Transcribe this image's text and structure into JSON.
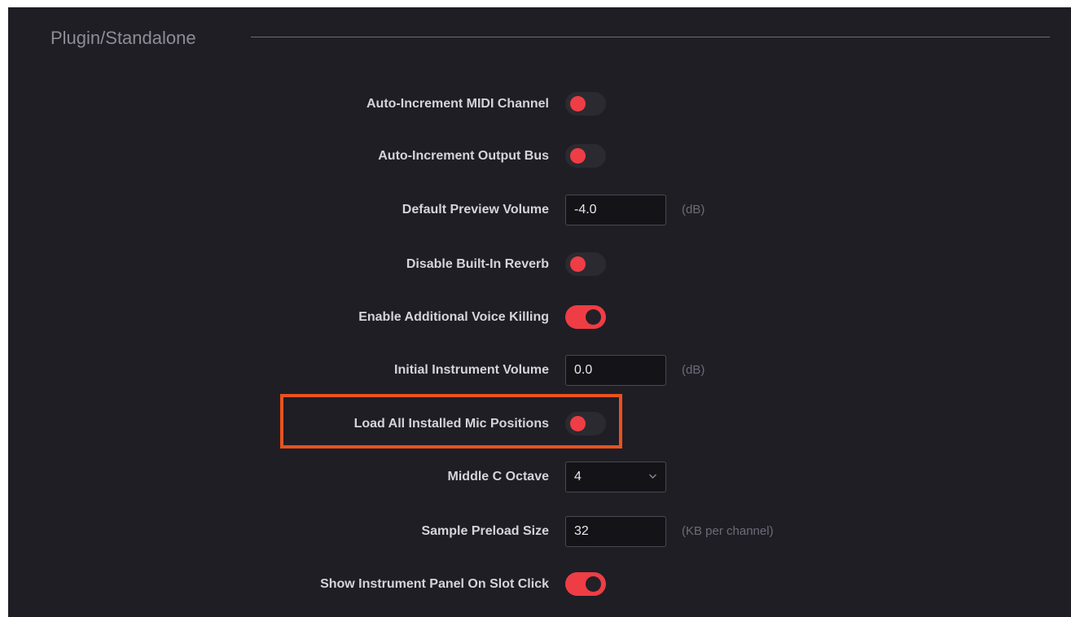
{
  "section": {
    "title": "Plugin/Standalone"
  },
  "settings": {
    "auto_increment_midi": {
      "label": "Auto-Increment MIDI Channel",
      "enabled": false
    },
    "auto_increment_output": {
      "label": "Auto-Increment Output Bus",
      "enabled": false
    },
    "default_preview_volume": {
      "label": "Default Preview Volume",
      "value": "-4.0",
      "unit": "(dB)"
    },
    "disable_reverb": {
      "label": "Disable Built-In Reverb",
      "enabled": false
    },
    "voice_killing": {
      "label": "Enable Additional Voice Killing",
      "enabled": true
    },
    "initial_volume": {
      "label": "Initial Instrument Volume",
      "value": "0.0",
      "unit": "(dB)"
    },
    "load_mic_positions": {
      "label": "Load All Installed Mic Positions",
      "enabled": false,
      "highlighted": true
    },
    "middle_c_octave": {
      "label": "Middle C Octave",
      "selected": "4"
    },
    "preload_size": {
      "label": "Sample Preload Size",
      "value": "32",
      "unit": "(KB per channel)"
    },
    "show_instrument_panel": {
      "label": "Show Instrument Panel On Slot Click",
      "enabled": true
    }
  },
  "colors": {
    "background": "#1f1e25",
    "accent": "#ee3d45",
    "highlight": "#e8521f"
  }
}
